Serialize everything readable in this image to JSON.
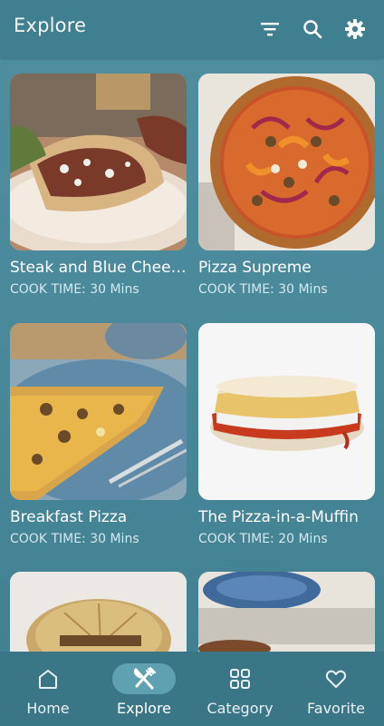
{
  "app_bar": {
    "title": "Explore",
    "icons": [
      "filter-icon",
      "search-icon",
      "gear-icon"
    ]
  },
  "recipes": [
    {
      "name": "Steak and Blue Cheese Pitas",
      "time_label": "COOK TIME: 30 Mins"
    },
    {
      "name": "Pizza Supreme",
      "time_label": "COOK TIME: 30 Mins"
    },
    {
      "name": "Breakfast Pizza",
      "time_label": "COOK TIME: 30 Mins"
    },
    {
      "name": "The Pizza-in-a-Muffin",
      "time_label": "COOK TIME: 20 Mins"
    },
    {
      "name": "",
      "time_label": ""
    },
    {
      "name": "",
      "time_label": ""
    }
  ],
  "bottom_nav": {
    "items": [
      {
        "label": "Home",
        "icon": "home-icon",
        "active": false
      },
      {
        "label": "Explore",
        "icon": "fork-knife-icon",
        "active": true
      },
      {
        "label": "Category",
        "icon": "grid-icon",
        "active": false
      },
      {
        "label": "Favorite",
        "icon": "heart-icon",
        "active": false
      }
    ]
  },
  "colors": {
    "app_bar": "#3f7f8f",
    "background": "#4a8a9b",
    "nav_bar": "#3b7686",
    "active_pill": "#5fa1b1"
  }
}
